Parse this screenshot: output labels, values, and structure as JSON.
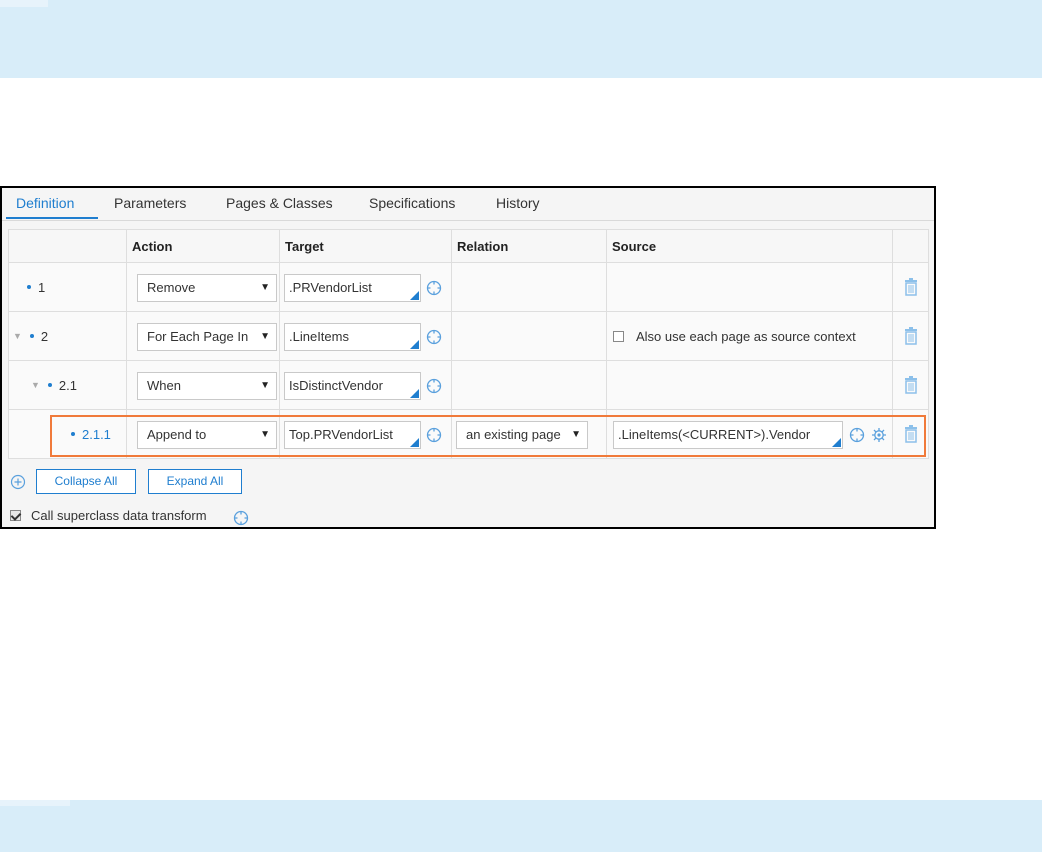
{
  "tabs": [
    {
      "label": "Definition",
      "active": true
    },
    {
      "label": "Parameters",
      "active": false
    },
    {
      "label": "Pages & Classes",
      "active": false
    },
    {
      "label": "Specifications",
      "active": false
    },
    {
      "label": "History",
      "active": false
    }
  ],
  "grid": {
    "headers": {
      "step": "",
      "action": "Action",
      "target": "Target",
      "relation": "Relation",
      "source": "Source"
    },
    "rows": [
      {
        "step": "1",
        "action": "Remove",
        "target": ".PRVendorList",
        "relation": "",
        "source": ""
      },
      {
        "step": "2",
        "action": "For Each Page In",
        "target": ".LineItems",
        "relation": "",
        "source_checkbox_label": "Also use each page as source context",
        "source_checkbox_checked": false
      },
      {
        "step": "2.1",
        "action": "When",
        "target": "IsDistinctVendor",
        "relation": "",
        "source": ""
      },
      {
        "step": "2.1.1",
        "action": "Append to",
        "target": "Top.PRVendorList",
        "relation": "an existing page",
        "source": ".LineItems(<CURRENT>).Vendor",
        "highlighted": true
      }
    ]
  },
  "buttons": {
    "collapse_all": "Collapse All",
    "expand_all": "Expand All"
  },
  "call_superclass": {
    "label": "Call superclass data transform",
    "checked": true
  },
  "colors": {
    "accent": "#1f7ecf",
    "highlight": "#f07a3a",
    "band": "#d8edf9"
  }
}
